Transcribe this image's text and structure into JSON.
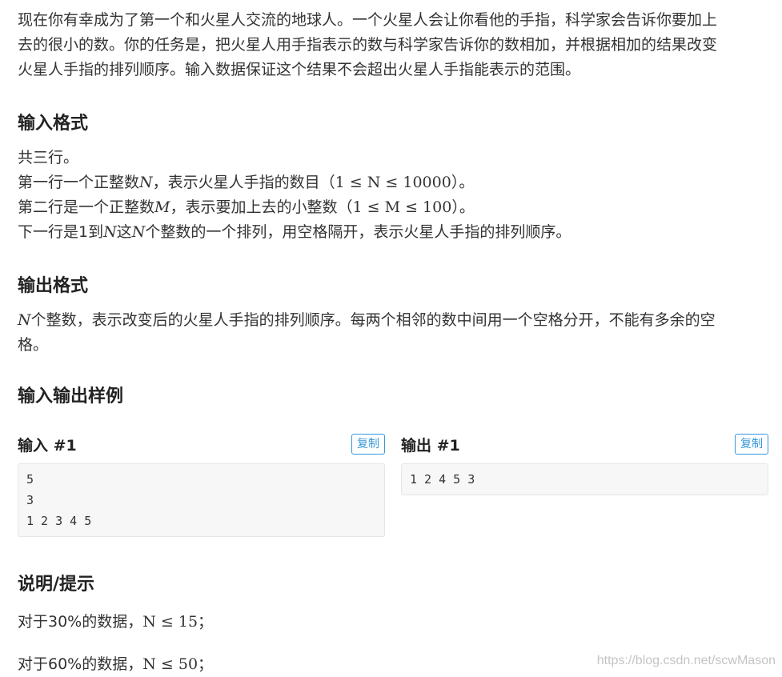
{
  "intro": {
    "line1": "现在你有幸成为了第一个和火星人交流的地球人。一个火星人会让你看他的手指，科学家会告诉你要加上",
    "line2": "去的很小的数。你的任务是，把火星人用手指表示的数与科学家告诉你的数相加，并根据相加的结果改变",
    "line3": "火星人手指的排列顺序。输入数据保证这个结果不会超出火星人手指能表示的范围。"
  },
  "input_format": {
    "heading": "输入格式",
    "l1": "共三行。",
    "l2_a": "第一行一个正整数",
    "l2_var": "N",
    "l2_b": "，表示火星人手指的数目（",
    "l2_math": "1 ≤ N ≤ 10000",
    "l2_c": "）。",
    "l3_a": "第二行是一个正整数",
    "l3_var": "M",
    "l3_b": "，表示要加上去的小整数（",
    "l3_math": "1 ≤ M ≤ 100",
    "l3_c": "）。",
    "l4_a": "下一行是1到",
    "l4_var": "N",
    "l4_b": "这",
    "l4_var2": "N",
    "l4_c": "个整数的一个排列，用空格隔开，表示火星人手指的排列顺序。"
  },
  "output_format": {
    "heading": "输出格式",
    "var": "N",
    "line1": "个整数，表示改变后的火星人手指的排列顺序。每两个相邻的数中间用一个空格分开，不能有多余的空",
    "line2": "格。"
  },
  "samples": {
    "heading": "输入输出样例",
    "input_title": "输入 #1",
    "output_title": "输出 #1",
    "copy_label": "复制",
    "input_lines": [
      "5",
      "3",
      "1 2 3 4 5"
    ],
    "output_lines": [
      "1 2 4 5 3"
    ]
  },
  "hint": {
    "heading": "说明/提示",
    "l1_a": "对于30%的数据，",
    "l1_math": "N ≤ 15",
    "l1_b": "；",
    "l2_a": "对于60%的数据，",
    "l2_math": "N ≤ 50",
    "l2_b": "；"
  },
  "watermark": "https://blog.csdn.net/scwMason"
}
